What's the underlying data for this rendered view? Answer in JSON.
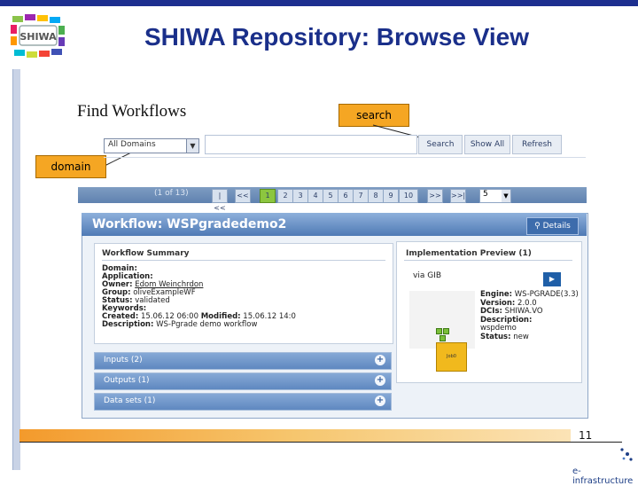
{
  "slide": {
    "title": "SHIWA Repository: Browse View",
    "page_number": "11",
    "logo_text": "SHIWA",
    "footer_logo_text": "e-infrastructure"
  },
  "find": {
    "title": "Find Workflows",
    "domain_select": "All Domains",
    "buttons": {
      "search": "Search",
      "show_all": "Show All",
      "refresh": "Refresh"
    }
  },
  "callouts": {
    "search": "search",
    "domain": "domain"
  },
  "pager": {
    "count": "(1 of 13)",
    "first": "|<<",
    "prev": "<<",
    "pages": [
      "1",
      "2",
      "3",
      "4",
      "5",
      "6",
      "7",
      "8",
      "9",
      "10"
    ],
    "next": ">>",
    "last": ">>|",
    "page_size": "5"
  },
  "workflow": {
    "title": "Workflow: WSPgradedemo2",
    "details_button": "Details",
    "summary": {
      "title": "Workflow Summary",
      "domain_label": "Domain:",
      "application_label": "Application:",
      "owner_label": "Owner:",
      "owner_value": "Edom Weinchrdon",
      "group_label": "Group:",
      "group_value": "oliveExampleWF",
      "status_label": "Status:",
      "status_value": "validated",
      "keywords_label": "Keywords:",
      "created_label": "Created:",
      "created_value": "15.06.12 06:00",
      "modified_label": "Modified:",
      "modified_value": "15.06.12 14:0",
      "description_label": "Description:",
      "description_value": "WS-Pgrade demo workflow"
    },
    "implementation": {
      "title": "Implementation Preview (1)",
      "via": "via GIB",
      "job_label": "Job0",
      "engine_label": "Engine:",
      "engine_value": "WS-PGRADE(3.3)",
      "version_label": "Version:",
      "version_value": "2.0.0",
      "dcis_label": "DCIs:",
      "dcis_value": "SHIWA.VO",
      "description_label": "Description:",
      "description_value": "wspdemo",
      "status_label": "Status:",
      "status_value": "new"
    },
    "sections": [
      "Inputs (2)",
      "Outputs (1)",
      "Data sets (1)"
    ]
  },
  "colors": {
    "title_blue": "#1a2f8a",
    "callout_orange": "#f5a623",
    "header_blue": "#4f7ab5",
    "active_page_green": "#8cc63f"
  }
}
